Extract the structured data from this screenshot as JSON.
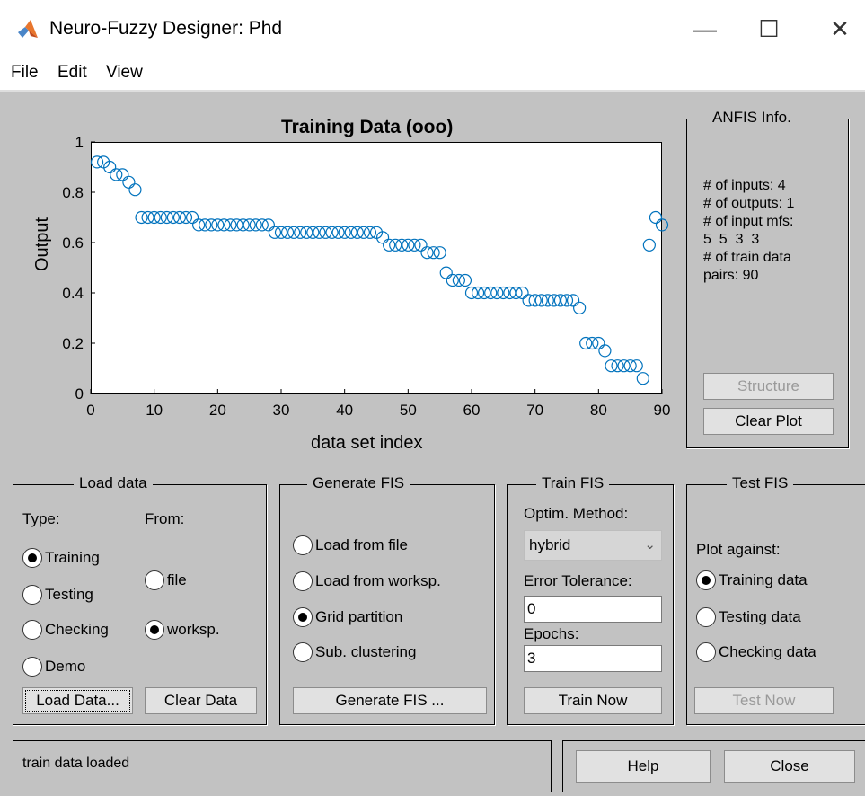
{
  "window": {
    "title": "Neuro-Fuzzy Designer: Phd",
    "minimize_glyph": "—",
    "maximize_glyph": "☐",
    "close_glyph": "✕",
    "logo_icon": "matlab-logo-icon"
  },
  "menu": {
    "file": "File",
    "edit": "Edit",
    "view": "View"
  },
  "chart_data": {
    "type": "scatter",
    "title": "Training Data (ooo)",
    "xlabel": "data set index",
    "ylabel": "Output",
    "xlim": [
      0,
      90
    ],
    "ylim": [
      0,
      1
    ],
    "xticks": [
      "0",
      "10",
      "20",
      "30",
      "40",
      "50",
      "60",
      "70",
      "80",
      "90"
    ],
    "yticks": [
      "0",
      "0.2",
      "0.4",
      "0.6",
      "0.8",
      "1"
    ],
    "marker": "circle-open",
    "color": "#0072bd",
    "grid": false,
    "points": [
      [
        1,
        0.92
      ],
      [
        2,
        0.92
      ],
      [
        3,
        0.9
      ],
      [
        4,
        0.87
      ],
      [
        5,
        0.87
      ],
      [
        6,
        0.84
      ],
      [
        7,
        0.81
      ],
      [
        8,
        0.7
      ],
      [
        9,
        0.7
      ],
      [
        10,
        0.7
      ],
      [
        11,
        0.7
      ],
      [
        12,
        0.7
      ],
      [
        13,
        0.7
      ],
      [
        14,
        0.7
      ],
      [
        15,
        0.7
      ],
      [
        16,
        0.7
      ],
      [
        17,
        0.67
      ],
      [
        18,
        0.67
      ],
      [
        19,
        0.67
      ],
      [
        20,
        0.67
      ],
      [
        21,
        0.67
      ],
      [
        22,
        0.67
      ],
      [
        23,
        0.67
      ],
      [
        24,
        0.67
      ],
      [
        25,
        0.67
      ],
      [
        26,
        0.67
      ],
      [
        27,
        0.67
      ],
      [
        28,
        0.67
      ],
      [
        29,
        0.64
      ],
      [
        30,
        0.64
      ],
      [
        31,
        0.64
      ],
      [
        32,
        0.64
      ],
      [
        33,
        0.64
      ],
      [
        34,
        0.64
      ],
      [
        35,
        0.64
      ],
      [
        36,
        0.64
      ],
      [
        37,
        0.64
      ],
      [
        38,
        0.64
      ],
      [
        39,
        0.64
      ],
      [
        40,
        0.64
      ],
      [
        41,
        0.64
      ],
      [
        42,
        0.64
      ],
      [
        43,
        0.64
      ],
      [
        44,
        0.64
      ],
      [
        45,
        0.64
      ],
      [
        46,
        0.62
      ],
      [
        47,
        0.59
      ],
      [
        48,
        0.59
      ],
      [
        49,
        0.59
      ],
      [
        50,
        0.59
      ],
      [
        51,
        0.59
      ],
      [
        52,
        0.59
      ],
      [
        53,
        0.56
      ],
      [
        54,
        0.56
      ],
      [
        55,
        0.56
      ],
      [
        56,
        0.48
      ],
      [
        57,
        0.45
      ],
      [
        58,
        0.45
      ],
      [
        59,
        0.45
      ],
      [
        60,
        0.4
      ],
      [
        61,
        0.4
      ],
      [
        62,
        0.4
      ],
      [
        63,
        0.4
      ],
      [
        64,
        0.4
      ],
      [
        65,
        0.4
      ],
      [
        66,
        0.4
      ],
      [
        67,
        0.4
      ],
      [
        68,
        0.4
      ],
      [
        69,
        0.37
      ],
      [
        70,
        0.37
      ],
      [
        71,
        0.37
      ],
      [
        72,
        0.37
      ],
      [
        73,
        0.37
      ],
      [
        74,
        0.37
      ],
      [
        75,
        0.37
      ],
      [
        76,
        0.37
      ],
      [
        77,
        0.34
      ],
      [
        78,
        0.2
      ],
      [
        79,
        0.2
      ],
      [
        80,
        0.2
      ],
      [
        81,
        0.17
      ],
      [
        82,
        0.11
      ],
      [
        83,
        0.11
      ],
      [
        84,
        0.11
      ],
      [
        85,
        0.11
      ],
      [
        86,
        0.11
      ],
      [
        87,
        0.06
      ],
      [
        88,
        0.59
      ],
      [
        89,
        0.7
      ],
      [
        90,
        0.67
      ]
    ]
  },
  "anfis_info": {
    "title": "ANFIS Info.",
    "lines": [
      "# of inputs: 4",
      "# of outputs: 1",
      "# of input mfs:",
      "5  5  3  3",
      "# of train data",
      "pairs: 90"
    ],
    "structure_button": "Structure",
    "clear_plot_button": "Clear Plot"
  },
  "load_data": {
    "title": "Load data",
    "type_label": "Type:",
    "from_label": "From:",
    "types": [
      {
        "label": "Training",
        "selected": true
      },
      {
        "label": "Testing",
        "selected": false
      },
      {
        "label": "Checking",
        "selected": false
      },
      {
        "label": "Demo",
        "selected": false
      }
    ],
    "sources": [
      {
        "label": "file",
        "selected": false
      },
      {
        "label": "worksp.",
        "selected": true
      }
    ],
    "load_button": "Load Data...",
    "clear_button": "Clear Data"
  },
  "generate_fis": {
    "title": "Generate FIS",
    "options": [
      {
        "label": "Load from file",
        "selected": false
      },
      {
        "label": "Load from worksp.",
        "selected": false
      },
      {
        "label": "Grid partition",
        "selected": true
      },
      {
        "label": "Sub. clustering",
        "selected": false
      }
    ],
    "button": "Generate FIS ..."
  },
  "train_fis": {
    "title": "Train FIS",
    "method_label": "Optim. Method:",
    "method_value": "hybrid",
    "error_label": "Error Tolerance:",
    "error_value": "0",
    "epochs_label": "Epochs:",
    "epochs_value": "3",
    "button": "Train Now"
  },
  "test_fis": {
    "title": "Test FIS",
    "plot_against_label": "Plot against:",
    "options": [
      {
        "label": "Training data",
        "selected": true
      },
      {
        "label": "Testing data",
        "selected": false
      },
      {
        "label": "Checking data",
        "selected": false
      }
    ],
    "button": "Test Now"
  },
  "status": {
    "text": "train data loaded"
  },
  "footer": {
    "help_button": "Help",
    "close_button": "Close"
  }
}
